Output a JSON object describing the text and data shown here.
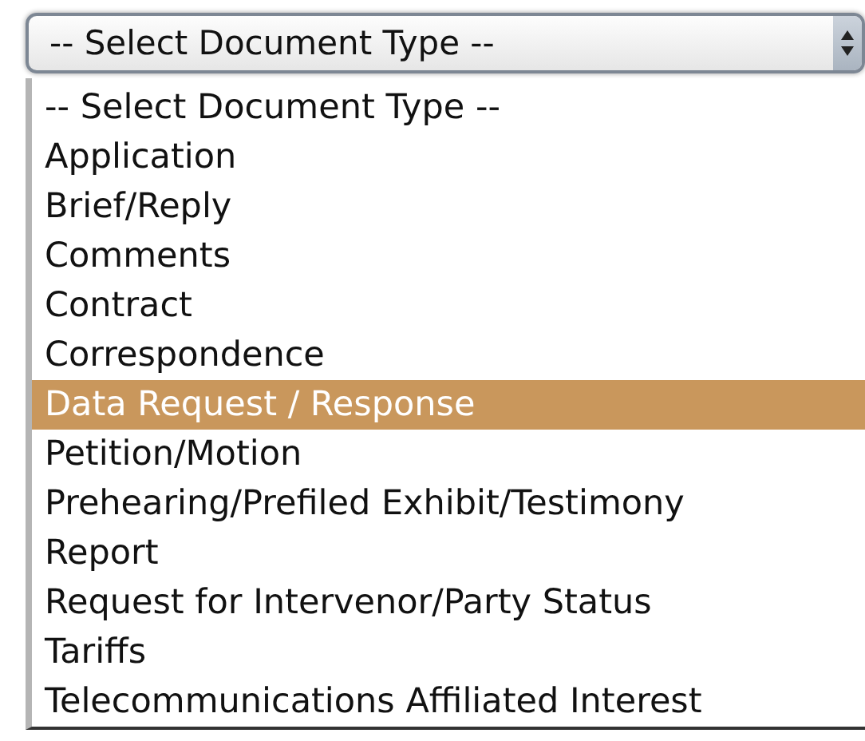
{
  "select": {
    "value": "-- Select Document Type --",
    "expanded": true
  },
  "options": [
    {
      "label": "-- Select Document Type --",
      "selected": false
    },
    {
      "label": "Application",
      "selected": false
    },
    {
      "label": "Brief/Reply",
      "selected": false
    },
    {
      "label": "Comments",
      "selected": false
    },
    {
      "label": "Contract",
      "selected": false
    },
    {
      "label": "Correspondence",
      "selected": false
    },
    {
      "label": "Data Request / Response",
      "selected": true
    },
    {
      "label": "Petition/Motion",
      "selected": false
    },
    {
      "label": "Prehearing/Prefiled Exhibit/Testimony",
      "selected": false
    },
    {
      "label": "Report",
      "selected": false
    },
    {
      "label": "Request for Intervenor/Party Status",
      "selected": false
    },
    {
      "label": "Tariffs",
      "selected": false
    },
    {
      "label": "Telecommunications Affiliated Interest",
      "selected": false
    }
  ]
}
